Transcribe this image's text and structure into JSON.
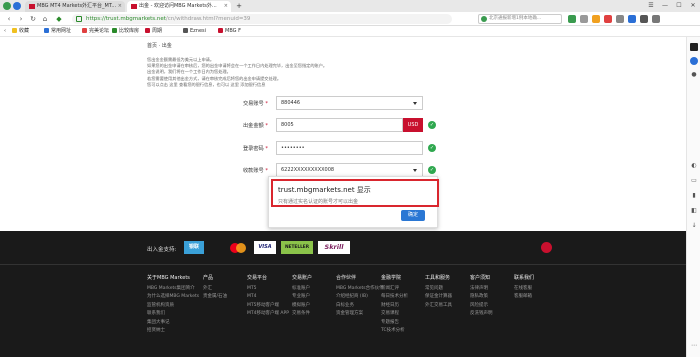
{
  "browser": {
    "tabs": [
      {
        "title": "MBG MT4 Markets外汇平台_MT..."
      },
      {
        "title": "出金 - 欢迎访问MBG Markets外..."
      }
    ],
    "new_tab": "+",
    "window_buttons": [
      "☰",
      "—",
      "☐",
      "✕"
    ],
    "url_host": "https://trust.mbgmarkets.net",
    "url_path": "/cn/withdraw.html?menuid=39",
    "search_placeholder": "北京通报新增1例本地确...",
    "bookmarks": [
      {
        "label": "收藏"
      },
      {
        "label": "常用网址"
      },
      {
        "label": "完美论坛"
      },
      {
        "label": "比较库房"
      },
      {
        "label": "周期"
      },
      {
        "label": "Eznesi"
      },
      {
        "label": "MBG F"
      }
    ]
  },
  "page": {
    "breadcrumb": "首页 · 出金",
    "intro_lines": [
      "您出金金额需最低为美元以上申请。",
      "如果您的出金申请在审核后，您的出金申请将会在一个工作日内处理完毕，出金至您指定的账户。",
      "出金说明，我们将在一个工作日内为您处理。",
      "若您需要使用其他出金方式，请在审核完成后将您的出金申请提交处理。",
      "您可以点击 这里 查看您的银行信息，也可以 这里 添加银行信息"
    ],
    "form": {
      "account_label": "交易账号",
      "account_value": "880446",
      "amount_label": "出金金额",
      "amount_value": "8005",
      "amount_unit": "USD",
      "password_label": "登录密码",
      "password_value": "••••••••",
      "bank_label": "收款账号",
      "bank_value": "6222XXXXXXXXX008"
    }
  },
  "dialog": {
    "title": "trust.mbgmarkets.net 显示",
    "message": "只有通过实名认证的账号才可以出金",
    "ok_label": "确定"
  },
  "footer": {
    "deposit_label": "出入金支持:",
    "payment_logos": [
      "银联",
      "VISA",
      "NETELLER",
      "Skrill"
    ],
    "columns": [
      {
        "head": "关于MBG Markets",
        "items": [
          "MBG Markets集团简介",
          "为什么选择MBG Markets",
          "监管机构资质",
          "联系我们",
          "集团大事记",
          "招贤纳士"
        ]
      },
      {
        "head": "产品",
        "items": [
          "外汇",
          "贵金属/石油"
        ]
      },
      {
        "head": "交易平台",
        "items": [
          "MT5",
          "MT4",
          "MT5移动客户端",
          "MT4移动客户端 APP"
        ]
      },
      {
        "head": "交易账户",
        "items": [
          "标准账户",
          "专业账户",
          "模拟账户",
          "交易条件"
        ]
      },
      {
        "head": "合作伙伴",
        "items": [
          "MBG Markets合作伙伴",
          "介绍经纪商 (IB)",
          "白标业务",
          "资金管理方案"
        ]
      },
      {
        "head": "金融学院",
        "items": [
          "新闻汇评",
          "每日技术分析",
          "财经日历",
          "交易课程",
          "专题报告",
          "TC技术分析"
        ]
      },
      {
        "head": "工具和服务",
        "items": [
          "常见问题",
          "保证金计算器",
          "外汇交易工具"
        ]
      },
      {
        "head": "客户须知",
        "items": [
          "法律声明",
          "隐私政策",
          "风险提示",
          "反洗钱声明"
        ]
      },
      {
        "head": "联系我们",
        "items": [
          "在线客服",
          "客服邮箱"
        ]
      }
    ]
  },
  "colors": {
    "brand_red": "#c8102e",
    "ok_blue": "#2a77d4",
    "success_green": "#2fa84f",
    "footer_bg": "#1a1a1a"
  }
}
